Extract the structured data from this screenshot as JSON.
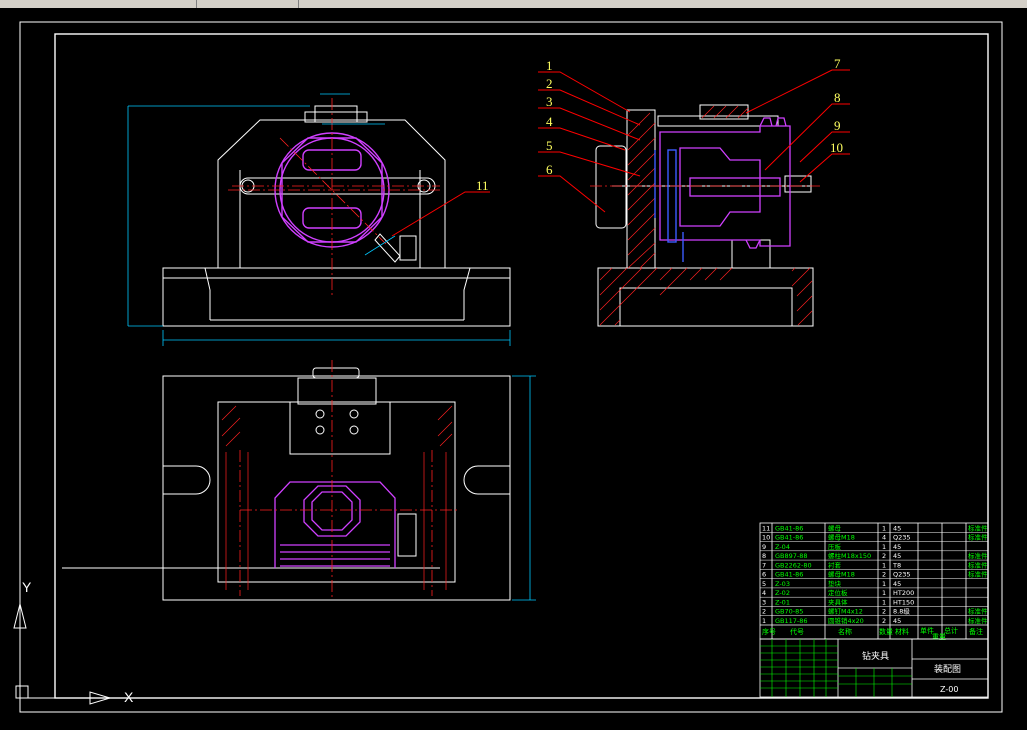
{
  "colors": {
    "background": "#000000",
    "outline": "#ffffff",
    "centerline": "#ff2020",
    "part_magenta": "#d040ff",
    "blue": "#3b5cff",
    "dimension_cyan": "#00c8ff",
    "table_green": "#00ff00",
    "leader_red": "#ff0000",
    "balloon_yellow": "#ffff60"
  },
  "balloons": [
    "1",
    "2",
    "3",
    "4",
    "5",
    "6",
    "7",
    "8",
    "9",
    "10",
    "11"
  ],
  "ucs": {
    "y_label": "Y",
    "x_label": "X"
  },
  "bom": {
    "rows": [
      {
        "no": "11",
        "code": "GB41-86",
        "name": "螺母",
        "qty": "1",
        "material": "45",
        "note": "标准件"
      },
      {
        "no": "10",
        "code": "GB41-86",
        "name": "螺母M18",
        "qty": "4",
        "material": "Q235",
        "note": "标准件"
      },
      {
        "no": "9",
        "code": "Z-04",
        "name": "压板",
        "qty": "1",
        "material": "45",
        "note": ""
      },
      {
        "no": "8",
        "code": "GB897-88",
        "name": "螺柱M18x150",
        "qty": "2",
        "material": "45",
        "note": "标准件"
      },
      {
        "no": "7",
        "code": "GB2262-80",
        "name": "衬套",
        "qty": "1",
        "material": "T8",
        "note": "标准件"
      },
      {
        "no": "6",
        "code": "GB41-86",
        "name": "螺母M18",
        "qty": "2",
        "material": "Q235",
        "note": "标准件"
      },
      {
        "no": "5",
        "code": "Z-03",
        "name": "垫块",
        "qty": "1",
        "material": "45",
        "note": ""
      },
      {
        "no": "4",
        "code": "Z-02",
        "name": "定位板",
        "qty": "1",
        "material": "HT200",
        "note": ""
      },
      {
        "no": "3",
        "code": "Z-01",
        "name": "夹具体",
        "qty": "1",
        "material": "HT150",
        "note": ""
      },
      {
        "no": "2",
        "code": "GB70-85",
        "name": "螺钉M4x12",
        "qty": "2",
        "material": "8.8级",
        "note": "标准件"
      },
      {
        "no": "1",
        "code": "GB117-86",
        "name": "圆锥销4x20",
        "qty": "2",
        "material": "45",
        "note": "标准件"
      }
    ],
    "header": {
      "no": "序号",
      "code": "代号",
      "name": "名称",
      "qty": "数量",
      "material": "材料",
      "weight_single": "单件",
      "weight_total": "总计",
      "weight_title": "重量",
      "note": "备注"
    }
  },
  "title_block": {
    "drawing_name": "钻夹具",
    "drawing_type": "装配图",
    "drawing_number": "Z-00"
  }
}
